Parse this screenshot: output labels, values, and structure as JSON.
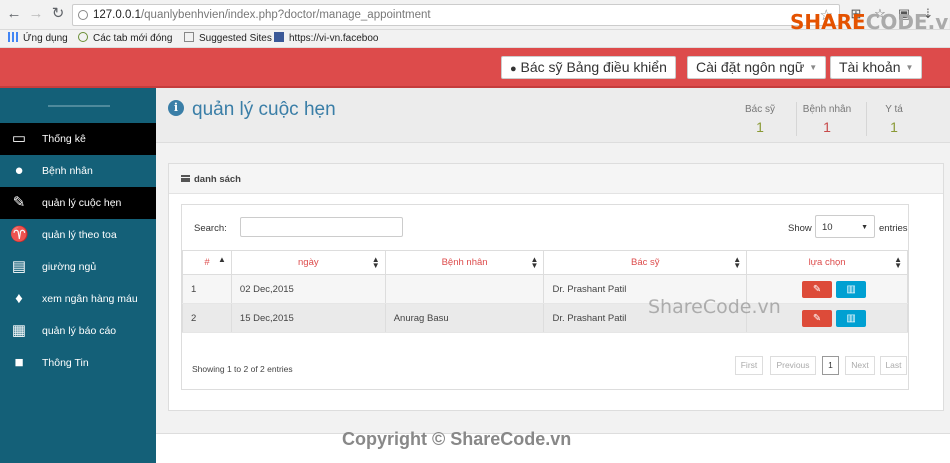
{
  "browser": {
    "url_host": "127.0.0.1",
    "url_path": "/quanlybenhvien/index.php?doctor/manage_appointment",
    "bookmarks": [
      {
        "label": "Ứng dụng"
      },
      {
        "label": "Các tab mới đóng"
      },
      {
        "label": "Suggested Sites"
      },
      {
        "label": "https://vi-vn.faceboo"
      }
    ]
  },
  "header": {
    "dashboard_label": "Bác sỹ Bảng điều khiển",
    "language_label": "Cài đặt ngôn ngữ",
    "account_label": "Tài khoản",
    "accent": "#dd4b4b"
  },
  "sidebar": {
    "items": [
      {
        "label": "Thống kê",
        "icon": "monitor-icon",
        "active": true
      },
      {
        "label": "Bệnh nhân",
        "icon": "user-icon"
      },
      {
        "label": "quản lý cuộc hẹn",
        "icon": "edit-icon",
        "active": true
      },
      {
        "label": "quản lý theo toa",
        "icon": "stethoscope-icon"
      },
      {
        "label": "giường ngủ",
        "icon": "hdd-icon"
      },
      {
        "label": "xem ngân hàng máu",
        "icon": "droplet-icon"
      },
      {
        "label": "quản lý báo cáo",
        "icon": "building-icon"
      },
      {
        "label": "Thông Tin",
        "icon": "lock-icon"
      }
    ],
    "bg_color": "#146078"
  },
  "page": {
    "title": "quản lý cuộc hẹn",
    "stats": [
      {
        "label": "Bác sỹ",
        "value": "1",
        "color": "#8a9a35"
      },
      {
        "label": "Bệnh nhân",
        "value": "1",
        "color": "#c74a4a"
      },
      {
        "label": "Y tá",
        "value": "1",
        "color": "#8a9a35"
      }
    ]
  },
  "panel": {
    "title": "danh sách"
  },
  "table": {
    "search_label": "Search:",
    "show_label": "Show",
    "page_size": "10",
    "entries_label": "entries",
    "columns": [
      "#",
      "ngày",
      "Bệnh nhân",
      "Bác sỹ",
      "lựa chọn"
    ],
    "rows": [
      {
        "num": "1",
        "date": "02 Dec,2015",
        "patient": "",
        "doctor": "Dr. Prashant Patil"
      },
      {
        "num": "2",
        "date": "15 Dec,2015",
        "patient": "Anurag Basu",
        "doctor": "Dr. Prashant Patil"
      }
    ],
    "info": "Showing 1 to 2 of 2 entries",
    "pagination": {
      "first": "First",
      "previous": "Previous",
      "current": "1",
      "next": "Next",
      "last": "Last"
    }
  },
  "watermarks": {
    "logo_share": "SHARE",
    "logo_code": "CODE.vn",
    "mid": "ShareCode.vn",
    "bottom": "Copyright © ShareCode.vn"
  }
}
